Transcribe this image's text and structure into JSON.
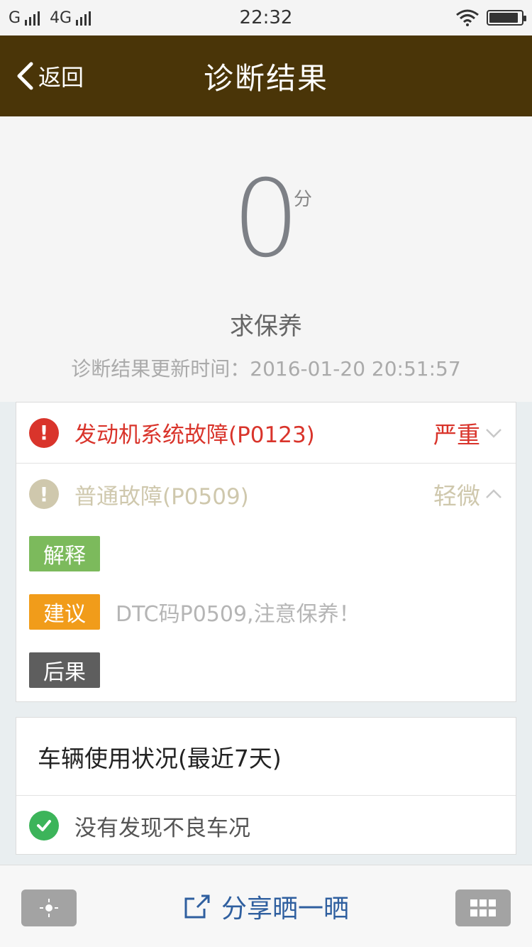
{
  "status_bar": {
    "carrier1": "G",
    "carrier2": "4G",
    "time": "22:32",
    "battery_level": 0.9
  },
  "nav": {
    "back_label": "返回",
    "title": "诊断结果"
  },
  "score": {
    "value": "0",
    "unit": "分",
    "status": "求保养",
    "update_time": "诊断结果更新时间：2016-01-20 20:51:57"
  },
  "faults": [
    {
      "title": "发动机系统故障(P0123)",
      "level": "严重",
      "color": "#d9342b",
      "expanded": false
    },
    {
      "title": "普通故障(P0509)",
      "level": "轻微",
      "color": "#cfc8ad",
      "expanded": true
    }
  ],
  "fault_details": {
    "explain_label": "解释",
    "explain_color": "#7cba5c",
    "advice_label": "建议",
    "advice_color": "#f19c1a",
    "advice_text": "DTC码P0509,注意保养！",
    "consequence_label": "后果",
    "consequence_color": "#5e5e5e"
  },
  "usage": {
    "title": "车辆使用状况(最近7天)",
    "status": "没有发现不良车况"
  },
  "bottom_bar": {
    "share_label": "分享晒一晒"
  },
  "colors": {
    "nav_bg": "#4a3508",
    "share_blue": "#2f5f9f",
    "ok_green": "#3cb45a"
  }
}
